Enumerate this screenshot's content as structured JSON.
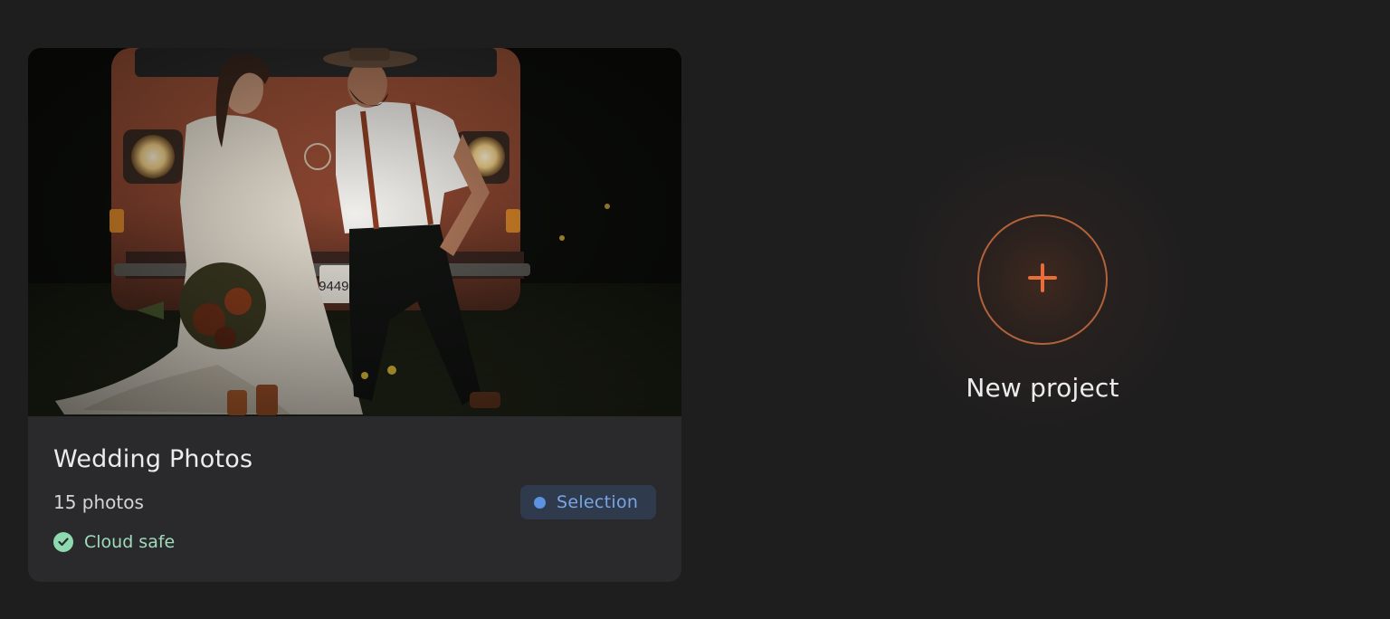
{
  "project_card": {
    "title": "Wedding Photos",
    "photo_count": "15 photos",
    "status_badge": "Selection",
    "cloud_status": "Cloud safe",
    "license_plate": "94494"
  },
  "new_project": {
    "label": "New project",
    "icon": "plus-icon"
  },
  "colors": {
    "background": "#1e1e1f",
    "card": "#2a2a2c",
    "accent_orange": "#e86d3a",
    "badge_bg": "#2f3a4c",
    "badge_text": "#78a6e6",
    "cloud_green": "#8fd9b0"
  }
}
